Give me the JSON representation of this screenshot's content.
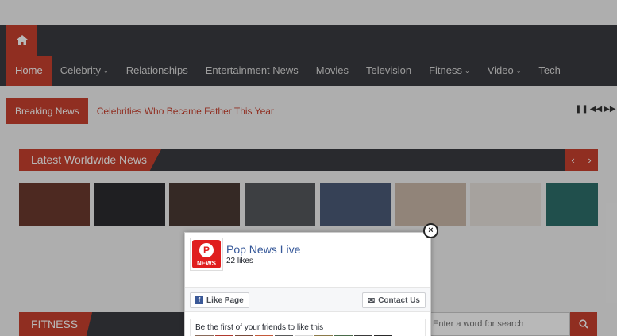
{
  "nav": {
    "home_icon": "home-icon",
    "items": [
      {
        "label": "Home",
        "active": true,
        "dropdown": false
      },
      {
        "label": "Celebrity",
        "active": false,
        "dropdown": true
      },
      {
        "label": "Relationships",
        "active": false,
        "dropdown": false
      },
      {
        "label": "Entertainment News",
        "active": false,
        "dropdown": false
      },
      {
        "label": "Movies",
        "active": false,
        "dropdown": false
      },
      {
        "label": "Television",
        "active": false,
        "dropdown": false
      },
      {
        "label": "Fitness",
        "active": false,
        "dropdown": true
      },
      {
        "label": "Video",
        "active": false,
        "dropdown": true
      },
      {
        "label": "Tech",
        "active": false,
        "dropdown": false
      }
    ]
  },
  "breaking": {
    "label": "Breaking News",
    "headline": "Celebrities Who Became Father This Year"
  },
  "latest": {
    "title": "Latest Worldwide News",
    "prev": "‹",
    "next": "›",
    "thumbs": [
      {
        "color": "#6b3a2e"
      },
      {
        "color": "#2c2b30"
      },
      {
        "color": "#4a3a34"
      },
      {
        "color": "#55585c"
      },
      {
        "color": "#4c5a78"
      },
      {
        "color": "#c9b8a8"
      },
      {
        "color": "#e6e1dc"
      },
      {
        "color": "#2d6e6a"
      }
    ]
  },
  "fitness": {
    "title": "FITNESS"
  },
  "search": {
    "placeholder": "Enter a word for search"
  },
  "popup": {
    "page_name": "Pop News Live",
    "likes": "22 likes",
    "like_button": "Like Page",
    "contact_button": "Contact Us",
    "friends_text": "Be the first of your friends to like this",
    "logo_text": "NEWS",
    "close_label": "×"
  },
  "colors": {
    "accent": "#c8412f",
    "nav_bg": "#3a3b40",
    "fb_blue": "#365899"
  }
}
